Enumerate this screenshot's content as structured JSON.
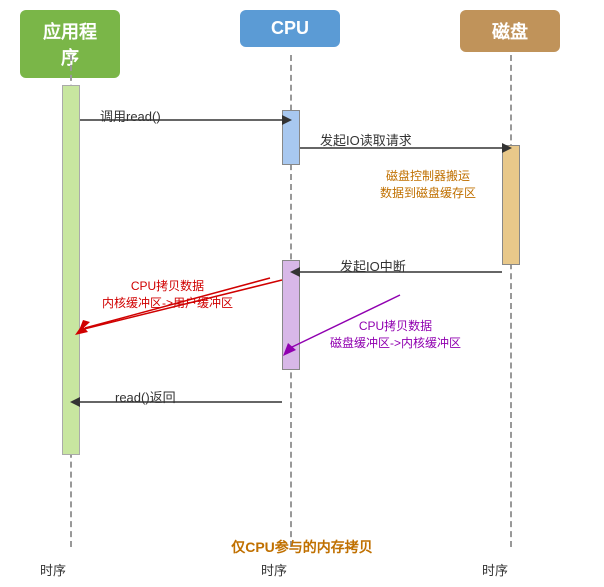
{
  "headers": {
    "app": "应用程序",
    "cpu": "CPU",
    "disk": "磁盘"
  },
  "labels": {
    "call_read": "调用read()",
    "io_read_request": "发起IO读取请求",
    "disk_controller": "磁盘控制器搬运",
    "data_to_disk_buf": "数据到磁盘缓存区",
    "io_interrupt": "发起IO中断",
    "cpu_copy_kernel": "CPU拷贝数据",
    "kernel_to_user": "内核缓冲区->用户缓冲区",
    "cpu_copy_disk": "CPU拷贝数据",
    "disk_to_kernel": "磁盘缓冲区->内核缓冲区",
    "read_return": "read()返回",
    "time1": "时序",
    "time2": "时序",
    "time3": "时序",
    "caption": "仅CPU参与的内存拷贝"
  }
}
